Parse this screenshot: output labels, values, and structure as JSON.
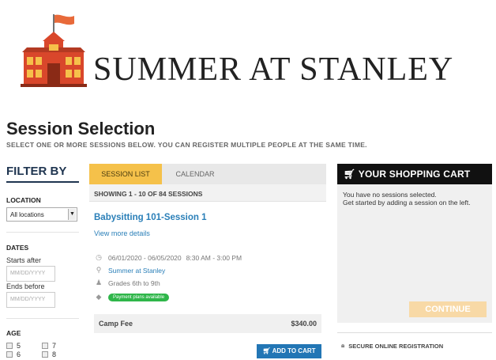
{
  "header": {
    "brand": "SUMMER AT STANLEY"
  },
  "page": {
    "title": "Session Selection",
    "subtitle": "SELECT ONE OR MORE SESSIONS BELOW. YOU CAN REGISTER MULTIPLE PEOPLE AT THE SAME TIME."
  },
  "filter": {
    "title": "FILTER BY",
    "location_label": "LOCATION",
    "location_value": "All locations",
    "dates_label": "DATES",
    "starts_after_label": "Starts after",
    "starts_after_placeholder": "MM/DD/YYYY",
    "ends_before_label": "Ends before",
    "ends_before_placeholder": "MM/DD/YYYY",
    "age_label": "AGE",
    "ages": [
      "5",
      "7",
      "6",
      "8"
    ]
  },
  "tabs": {
    "session_list": "SESSION LIST",
    "calendar": "CALENDAR"
  },
  "showing": "SHOWING 1 - 10 OF 84 SESSIONS",
  "session": {
    "title": "Babysitting 101-Session 1",
    "details_link": "View more details",
    "dates": "06/01/2020 - 06/05/2020",
    "time": "8:30 AM - 3:00 PM",
    "location": "Summer at Stanley",
    "grades": "Grades 6th to 9th",
    "badge": "Payment plans available",
    "fee_label": "Camp Fee",
    "fee_amount": "$340.00",
    "add_to_cart": "ADD TO CART"
  },
  "cart": {
    "title": "YOUR SHOPPING CART",
    "empty_line1": "You have no sessions selected.",
    "empty_line2": "Get started by adding a session on the left.",
    "continue": "CONTINUE",
    "secure": "SECURE ONLINE REGISTRATION"
  },
  "colors": {
    "accent_blue": "#2a7fb8",
    "tab_active": "#f5c14a",
    "badge_green": "#2fb64a",
    "logo_red": "#d9472b",
    "continue_disabled": "#f8d9a6"
  },
  "icons": [
    "schoolhouse-logo",
    "clock-icon",
    "map-pin-icon",
    "person-icon",
    "tag-icon",
    "cart-icon",
    "lock-icon"
  ]
}
